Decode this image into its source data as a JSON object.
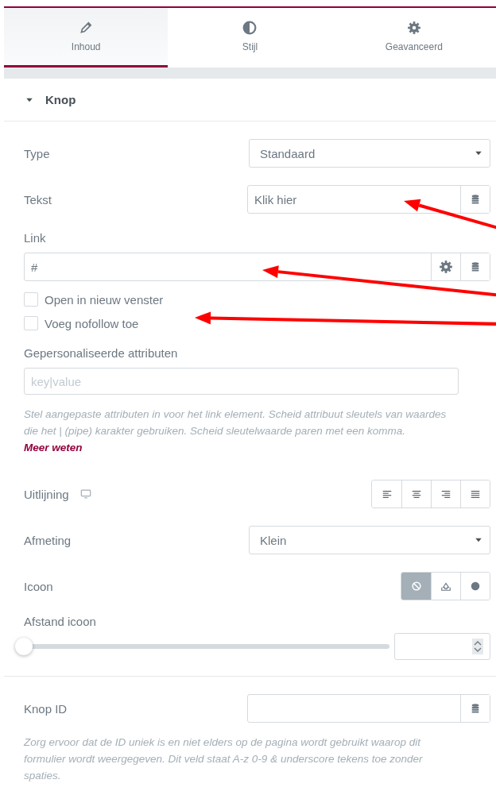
{
  "tabs": [
    {
      "label": "Inhoud",
      "selected": true
    },
    {
      "label": "Stijl",
      "selected": false
    },
    {
      "label": "Geavanceerd",
      "selected": false
    }
  ],
  "section": {
    "title": "Knop",
    "expanded": true
  },
  "controls": [
    {
      "kind": "select",
      "label": "Type",
      "value": "Standaard"
    },
    {
      "kind": "text",
      "label": "Tekst",
      "value": "Klik hier"
    },
    {
      "kind": "url",
      "label": "Link",
      "value": "#"
    },
    {
      "kind": "checkbox",
      "label": "Open in nieuw venster",
      "checked": false
    },
    {
      "kind": "checkbox",
      "label": "Voeg nofollow toe",
      "checked": false
    },
    {
      "kind": "wide",
      "label": "Gepersonaliseerde attributen",
      "placeholder": "key|value"
    },
    {
      "kind": "help",
      "text": "Stel aangepaste attributen in voor het link element. Scheid attribuut sleutels van waardes die het | (pipe) karakter gebruiken. Scheid sleutelwaarde paren met een komma.",
      "link": "Meer weten"
    },
    {
      "kind": "choose",
      "label": "Uitlijning",
      "responsive": true,
      "options": [
        {
          "selected": false
        },
        {
          "selected": false
        },
        {
          "selected": false
        },
        {
          "selected": false
        }
      ]
    },
    {
      "kind": "select",
      "label": "Afmeting",
      "value": "Klein"
    },
    {
      "kind": "choose",
      "label": "Icoon",
      "responsive": false,
      "options": [
        {
          "selected": true
        },
        {
          "selected": false
        },
        {
          "selected": false
        }
      ]
    },
    {
      "kind": "slider",
      "label": "Afstand icoon",
      "level": 0
    },
    {
      "kind": "divider"
    },
    {
      "kind": "text",
      "label": "Knop ID"
    },
    {
      "kind": "help",
      "text": "Zorg ervoor dat de ID uniek is en niet elders op de pagina wordt gebruikt waarop dit formulier wordt weergegeven. Dit veld staat A-z  0-9 & underscore tekens toe zonder spaties."
    }
  ]
}
